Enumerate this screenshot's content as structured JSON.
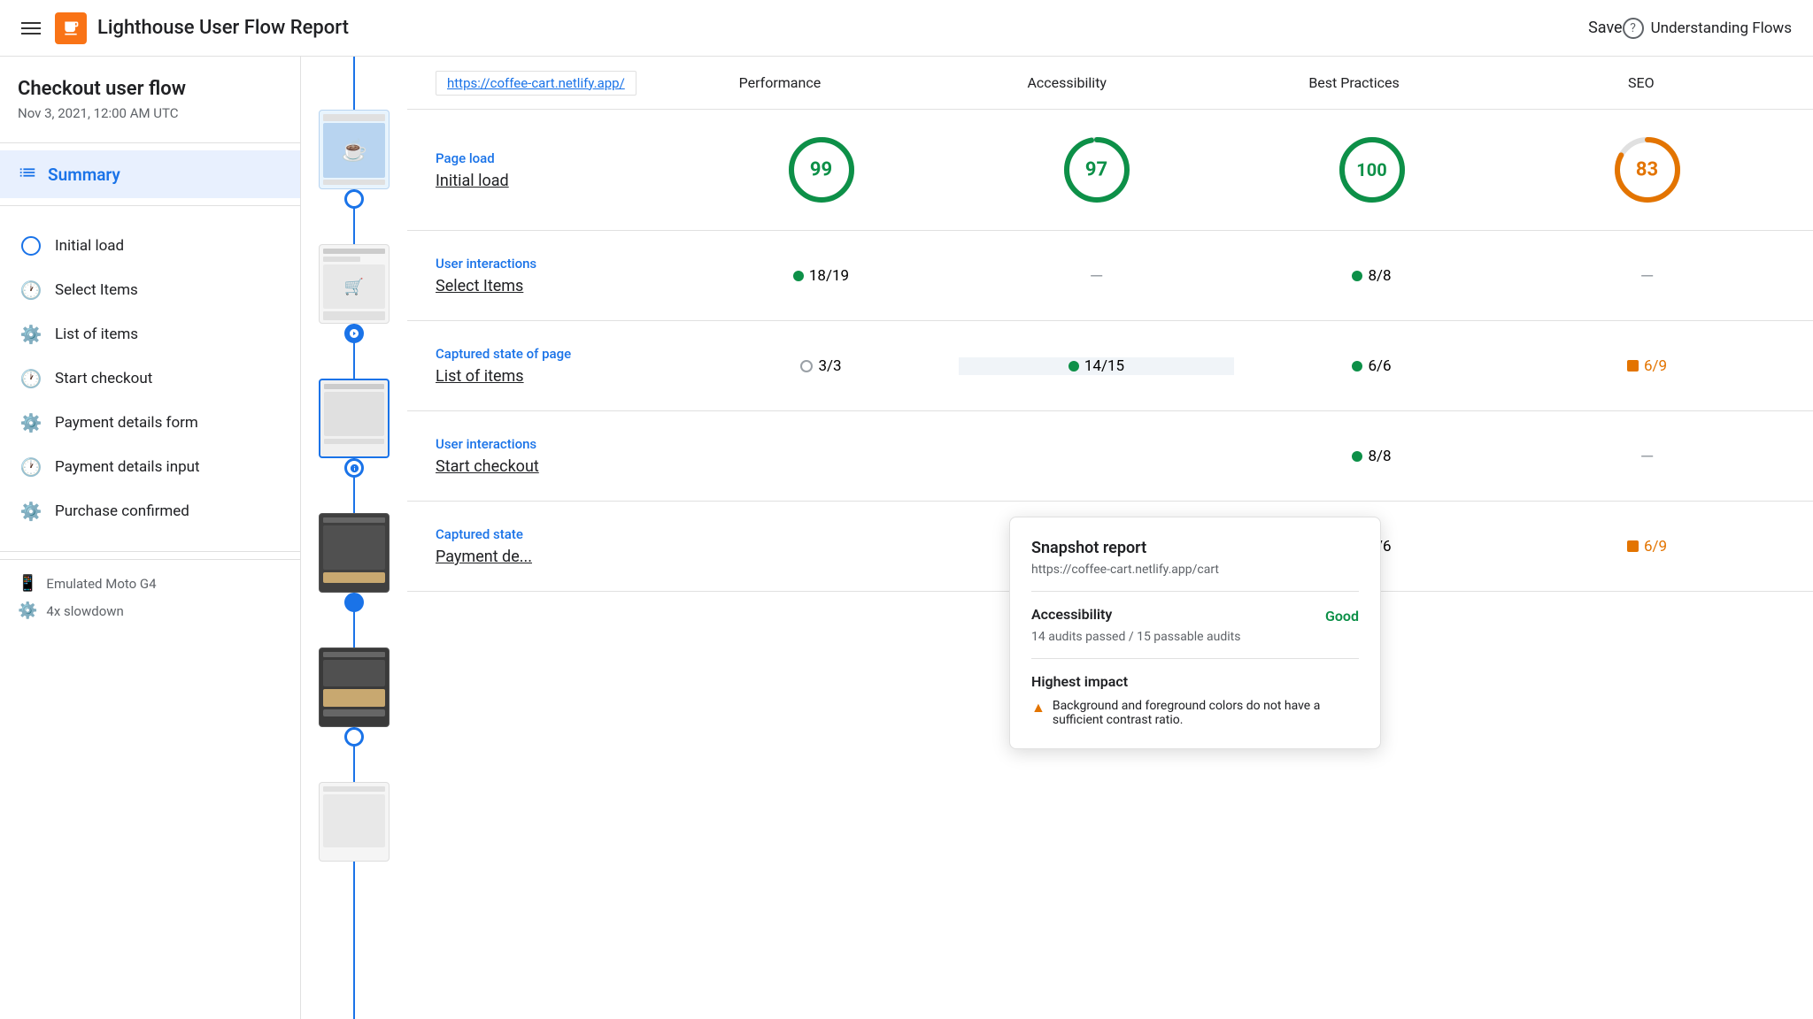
{
  "header": {
    "title": "Lighthouse User Flow Report",
    "save_label": "Save",
    "understanding_flows_label": "Understanding Flows"
  },
  "sidebar": {
    "flow_title": "Checkout user flow",
    "date": "Nov 3, 2021, 12:00 AM UTC",
    "summary_label": "Summary",
    "items": [
      {
        "id": "initial-load",
        "label": "Initial load",
        "icon": "circle"
      },
      {
        "id": "select-items",
        "label": "Select Items",
        "icon": "clock"
      },
      {
        "id": "list-of-items",
        "label": "List of items",
        "icon": "snapshot"
      },
      {
        "id": "start-checkout",
        "label": "Start checkout",
        "icon": "clock"
      },
      {
        "id": "payment-details-form",
        "label": "Payment details form",
        "icon": "snapshot"
      },
      {
        "id": "payment-details-input",
        "label": "Payment details input",
        "icon": "clock"
      },
      {
        "id": "purchase-confirmed",
        "label": "Purchase confirmed",
        "icon": "snapshot"
      }
    ],
    "device_label": "Emulated Moto G4",
    "slowdown_label": "4x slowdown"
  },
  "category_bar": {
    "url": "https://coffee-cart.netlify.app/",
    "categories": [
      "Performance",
      "Accessibility",
      "Best Practices",
      "SEO"
    ]
  },
  "sections": [
    {
      "type": "Page load",
      "name": "Initial load",
      "scores": [
        {
          "kind": "circle",
          "value": "99",
          "color": "green"
        },
        {
          "kind": "circle",
          "value": "97",
          "color": "green"
        },
        {
          "kind": "circle",
          "value": "100",
          "color": "green"
        },
        {
          "kind": "circle",
          "value": "83",
          "color": "orange"
        }
      ]
    },
    {
      "type": "User interactions",
      "name": "Select Items",
      "scores": [
        {
          "kind": "pill",
          "value": "18/19",
          "dot": "green"
        },
        {
          "kind": "dash"
        },
        {
          "kind": "pill",
          "value": "8/8",
          "dot": "green"
        },
        {
          "kind": "dash"
        }
      ]
    },
    {
      "type": "Captured state of page",
      "name": "List of items",
      "scores": [
        {
          "kind": "pill",
          "value": "3/3",
          "dot": "outline"
        },
        {
          "kind": "pill",
          "value": "14/15",
          "dot": "green",
          "highlighted": true
        },
        {
          "kind": "pill",
          "value": "6/6",
          "dot": "green"
        },
        {
          "kind": "pill",
          "value": "6/9",
          "dot": "square-orange"
        }
      ]
    },
    {
      "type": "User interactions",
      "name": "Start checkout",
      "scores": [
        {
          "kind": "hidden"
        },
        {
          "kind": "hidden"
        },
        {
          "kind": "pill",
          "value": "8/8",
          "dot": "green"
        },
        {
          "kind": "dash"
        }
      ]
    },
    {
      "type": "Captured state",
      "name": "Payment de...",
      "scores": [
        {
          "kind": "hidden"
        },
        {
          "kind": "hidden"
        },
        {
          "kind": "pill",
          "value": "6/6",
          "dot": "green"
        },
        {
          "kind": "pill",
          "value": "6/9",
          "dot": "square-orange"
        }
      ]
    }
  ],
  "tooltip": {
    "title": "Snapshot report",
    "url": "https://coffee-cart.netlify.app/cart",
    "accessibility_label": "Accessibility",
    "accessibility_value": "Good",
    "accessibility_desc": "14 audits passed / 15 passable audits",
    "highest_impact_label": "Highest impact",
    "impact_item": "Background and foreground colors do not have a sufficient contrast ratio."
  }
}
